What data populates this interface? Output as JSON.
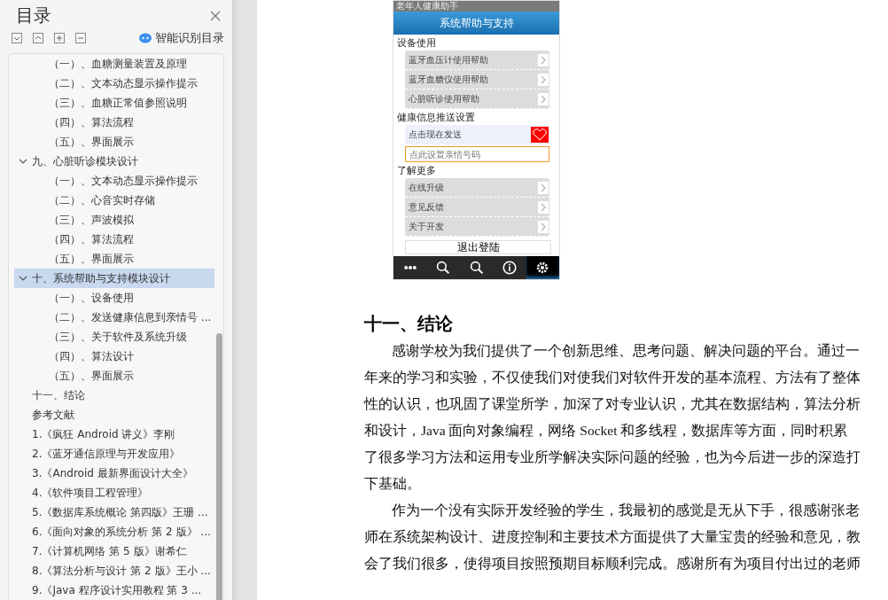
{
  "toc": {
    "title": "目录",
    "smart_button": "智能识别目录",
    "continued_items": [
      {
        "label": "（一）、血糖测量装置及原理"
      },
      {
        "label": "（二）、文本动态显示操作提示"
      },
      {
        "label": "（三）、血糖正常值参照说明"
      },
      {
        "label": "（四）、算法流程"
      },
      {
        "label": "（五）、界面展示"
      }
    ],
    "items": [
      {
        "label": "九、心脏听诊模块设计",
        "expanded": true,
        "selected": false,
        "children": [
          {
            "label": "（一）、文本动态显示操作提示"
          },
          {
            "label": "（二）、心音实时存储"
          },
          {
            "label": "（三）、声波模拟"
          },
          {
            "label": "（四）、算法流程"
          },
          {
            "label": "（五）、界面展示"
          }
        ]
      },
      {
        "label": "十、系统帮助与支持模块设计",
        "expanded": true,
        "selected": true,
        "children": [
          {
            "label": "（一）、设备使用"
          },
          {
            "label": "（二）、发送健康信息到亲情号 ..."
          },
          {
            "label": "（三）、关于软件及系统升级"
          },
          {
            "label": "（四）、算法设计"
          },
          {
            "label": "（五）、界面展示"
          }
        ]
      },
      {
        "label": "十一、结论",
        "selected": false
      },
      {
        "label": "参考文献",
        "selected": false
      },
      {
        "label": "1.《疯狂 Android 讲义》李刚",
        "selected": false
      },
      {
        "label": "2.《蓝牙通信原理与开发应用》",
        "selected": false
      },
      {
        "label": "3.《Android 最新界面设计大全》",
        "selected": false
      },
      {
        "label": "4.《软件项目工程管理》",
        "selected": false
      },
      {
        "label": "5.《数据库系统概论  第四版》王珊 ...",
        "selected": false
      },
      {
        "label": "6.《面向对象的系统分析  第 2 版》 ...",
        "selected": false
      },
      {
        "label": "7.《计算机网络  第 5 版》谢希仁",
        "selected": false
      },
      {
        "label": "8.《算法分析与设计  第 2 版》王小 ...",
        "selected": false
      },
      {
        "label": "9.《Java 程序设计实用教程  第 3 ...",
        "selected": false
      }
    ]
  },
  "phone": {
    "status_title": "老年人健康助手",
    "header": "系统帮助与支持",
    "sections": [
      {
        "kind": "list",
        "heading": "设备使用",
        "rows": [
          "蓝牙血压计使用帮助",
          "蓝牙血糖仪使用帮助",
          "心脏听诊使用帮助"
        ]
      },
      {
        "kind": "push",
        "heading": "健康信息推送设置",
        "send_label": "点击现在发送",
        "number_placeholder": "点此设置亲情号码"
      },
      {
        "kind": "list",
        "heading": "了解更多",
        "rows": [
          "在线升级",
          "意见反馈",
          "关于开发"
        ]
      }
    ],
    "logout_button": "退出登陆",
    "tabs": [
      {
        "kind": "dots",
        "selected": false
      },
      {
        "kind": "search",
        "selected": false
      },
      {
        "kind": "search",
        "selected": false
      },
      {
        "kind": "info",
        "selected": false
      },
      {
        "kind": "gear",
        "selected": true
      }
    ]
  },
  "document": {
    "heading": "十一、结论",
    "paragraphs": [
      "感谢学校为我们提供了一个创新思维、思考问题、解决问题的平台。通过一年来的学习和实验，不仅使我们对使我们对软件开发的基本流程、方法有了整体性的认识，也巩固了课堂所学，加深了对专业认识，尤其在数据结构，算法分析和设计，Java 面向对象编程，网络 Socket 和多线程，数据库等方面，同时积累了很多学习方法和运用专业所学解决实际问题的经验，也为今后进一步的深造打下基础。",
      "作为一个没有实际开发经验的学生，我最初的感觉是无从下手，很感谢张老师在系统架构设计、进度控制和主要技术方面提供了大量宝贵的经验和意见，教会了我们很多，使得项目按照预期目标顺利完成。感谢所有为项目付出过的老师"
    ]
  }
}
